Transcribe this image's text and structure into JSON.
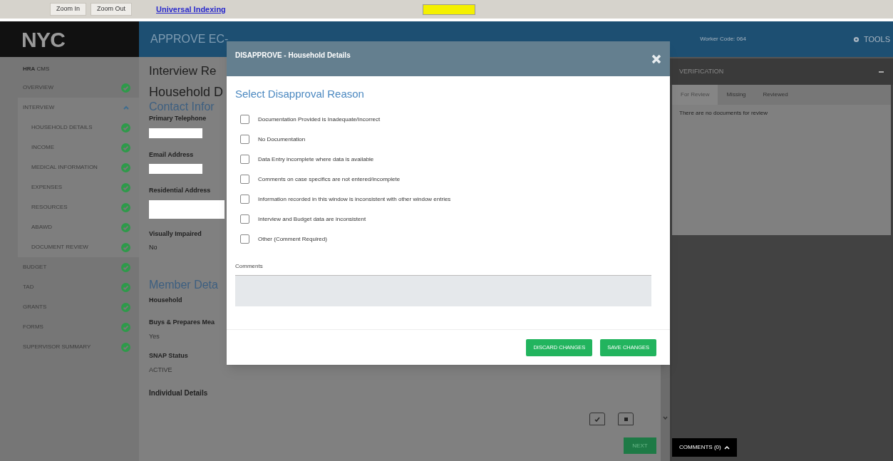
{
  "toolbar": {
    "buttons": [
      "Zoom In",
      "Zoom Out"
    ],
    "link": "Universal Indexing"
  },
  "header": {
    "logo": "NYC",
    "title": "APPROVE EC-",
    "worker": "Worker Code: 064",
    "tools": "TOOLS"
  },
  "sidebar": {
    "title_bold": "HRA",
    "title": "CMS",
    "items": [
      {
        "label": "OVERVIEW",
        "done": true
      },
      {
        "label": "INTERVIEW",
        "expanded": true,
        "children": [
          {
            "label": "HOUSEHOLD DETAILS",
            "done": true
          },
          {
            "label": "INCOME",
            "done": true
          },
          {
            "label": "MEDICAL INFORMATION",
            "done": true
          },
          {
            "label": "EXPENSES",
            "done": true
          },
          {
            "label": "RESOURCES",
            "done": true
          },
          {
            "label": "ABAWD",
            "done": true
          },
          {
            "label": "DOCUMENT REVIEW",
            "done": true
          }
        ]
      },
      {
        "label": "BUDGET",
        "done": true
      },
      {
        "label": "TAD",
        "done": true
      },
      {
        "label": "GRANTS",
        "done": true
      },
      {
        "label": "FORMS",
        "done": true
      },
      {
        "label": "SUPERVISOR SUMMARY",
        "done": true
      }
    ]
  },
  "main": {
    "page_title": "Interview Re",
    "section_title": "Household D",
    "contact_heading": "Contact Infor",
    "fields": [
      {
        "label": "Primary Telephone",
        "kind": "redacted"
      },
      {
        "label": "Email Address",
        "kind": "redacted"
      },
      {
        "label": "Residential Address",
        "kind": "redacted_large"
      },
      {
        "label": "Visually Impaired",
        "kind": "text",
        "value": "No"
      }
    ],
    "member_heading": "Member Deta",
    "household_label": "Household",
    "member_fields": [
      {
        "label": "Buys & Prepares Mea",
        "value": "Yes"
      },
      {
        "label": "SNAP Status",
        "value": "ACTIVE"
      }
    ],
    "individual_details": "Individual Details",
    "next": "NEXT"
  },
  "verification": {
    "title": "VERIFICATION",
    "tabs": [
      {
        "label": "For Review",
        "selected": true
      },
      {
        "label": "Missing",
        "selected": false
      },
      {
        "label": "Reviewed",
        "selected": false
      }
    ],
    "message": "There are no documents for review",
    "comments_button": "COMMENTS (0)"
  },
  "dialog": {
    "title": "DISAPPROVE - Household Details",
    "heading": "Select Disapproval Reason",
    "reasons": [
      {
        "label": "Documentation Provided is Inadequate/Incorrect",
        "checked": false
      },
      {
        "label": "No Documentation",
        "checked": false
      },
      {
        "label": "Data Entry incomplete where data is available",
        "checked": false
      },
      {
        "label": "Comments on case specifics are not entered/incomplete",
        "checked": false
      },
      {
        "label": "Information recorded in this window is inconsistent with other window entries",
        "checked": false
      },
      {
        "label": "Interview and Budget data are inconsistent",
        "checked": false
      },
      {
        "label": "Other (Comment Required)",
        "checked": false
      }
    ],
    "comments_label": "Comments",
    "buttons": [
      "DISCARD CHANGES",
      "SAVE CHANGES"
    ]
  }
}
